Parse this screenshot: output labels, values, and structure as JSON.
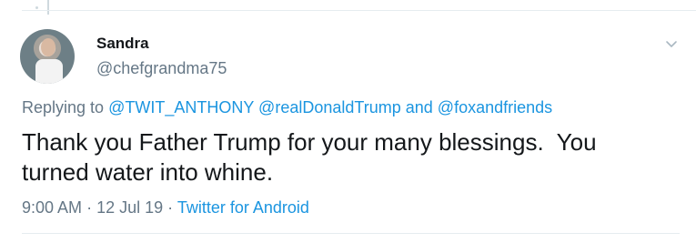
{
  "user": {
    "display_name": "Sandra",
    "handle": "@chefgrandma75"
  },
  "reply": {
    "prefix": "Replying to",
    "mentions": [
      "@TWIT_ANTHONY",
      "@realDonaldTrump",
      "@foxandfriends"
    ],
    "conjunction": "and"
  },
  "tweet": {
    "line1": "Thank you Father Trump for your many blessings.  You",
    "line2": "turned water into whine."
  },
  "meta": {
    "time": "9:00 AM",
    "separator": "·",
    "date": "12 Jul 19",
    "source": "Twitter for Android"
  },
  "icons": {
    "menu": "chevron-down-icon",
    "avatar": "avatar"
  },
  "colors": {
    "primary_text": "#14171a",
    "secondary_text": "#657786",
    "link": "#1b95e0",
    "divider": "#e6ecf0"
  }
}
